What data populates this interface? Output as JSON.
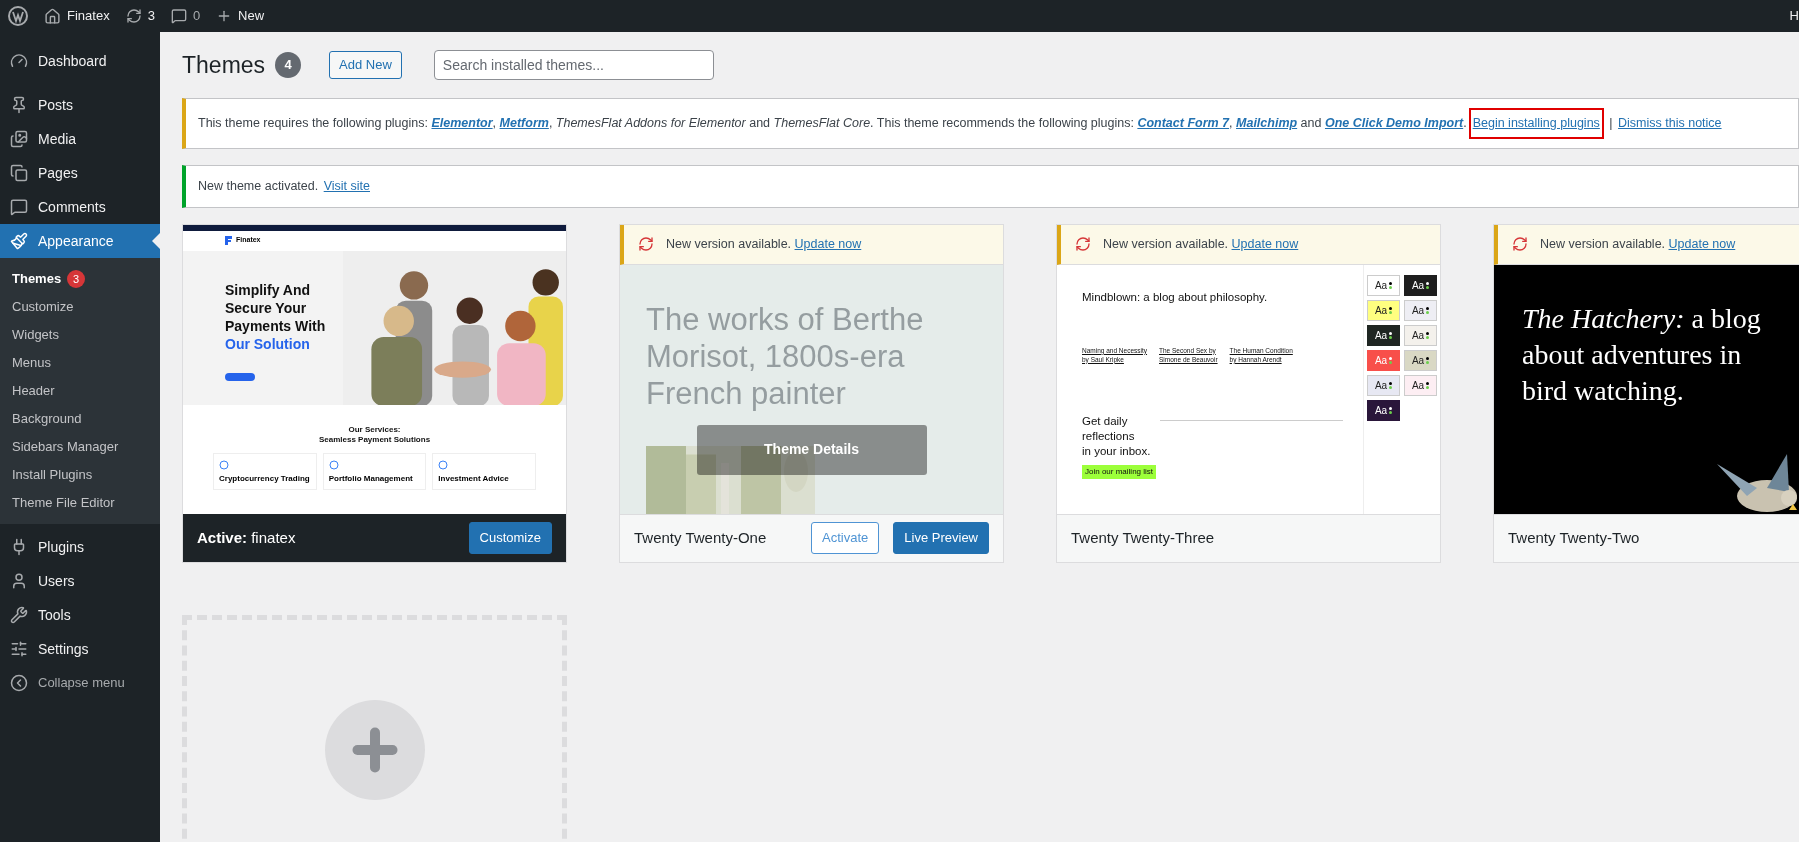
{
  "admin_bar": {
    "site": "Finatex",
    "updates": "3",
    "comments": "0",
    "new": "New",
    "account": "H"
  },
  "sidebar": {
    "items": [
      {
        "label": "Dashboard",
        "selected": false
      },
      {
        "label": "Posts",
        "selected": false
      },
      {
        "label": "Media",
        "selected": false
      },
      {
        "label": "Pages",
        "selected": false
      },
      {
        "label": "Comments",
        "selected": false
      },
      {
        "label": "Appearance",
        "selected": true,
        "children": [
          {
            "label": "Themes",
            "selected": true,
            "badge": "3"
          },
          {
            "label": "Customize",
            "selected": false
          },
          {
            "label": "Widgets",
            "selected": false
          },
          {
            "label": "Menus",
            "selected": false
          },
          {
            "label": "Header",
            "selected": false
          },
          {
            "label": "Background",
            "selected": false
          },
          {
            "label": "Sidebars Manager",
            "selected": false
          },
          {
            "label": "Install Plugins",
            "selected": false
          },
          {
            "label": "Theme File Editor",
            "selected": false
          }
        ]
      },
      {
        "label": "Plugins",
        "selected": false
      },
      {
        "label": "Users",
        "selected": false
      },
      {
        "label": "Tools",
        "selected": false
      },
      {
        "label": "Settings",
        "selected": false
      }
    ],
    "collapse": "Collapse menu"
  },
  "page": {
    "title": "Themes",
    "count": "4",
    "add_new": "Add New",
    "search": {
      "placeholder": "Search installed themes..."
    }
  },
  "notices": [
    {
      "kind": "warning",
      "parts": [
        {
          "kind": "text",
          "text": "This theme requires the following plugins: "
        },
        {
          "kind": "link",
          "text": "Elementor"
        },
        {
          "kind": "text",
          "text": ", "
        },
        {
          "kind": "link",
          "text": "Metform"
        },
        {
          "kind": "text",
          "text": ", "
        },
        {
          "kind": "italic",
          "text": "ThemesFlat Addons for Elementor"
        },
        {
          "kind": "text",
          "text": " and "
        },
        {
          "kind": "italic",
          "text": "ThemesFlat Core"
        },
        {
          "kind": "text",
          "text": ". This theme recommends the following plugins: "
        },
        {
          "kind": "link",
          "text": "Contact Form 7"
        },
        {
          "kind": "text",
          "text": ", "
        },
        {
          "kind": "link",
          "text": "Mailchimp"
        },
        {
          "kind": "text",
          "text": " and "
        },
        {
          "kind": "link",
          "text": "One Click Demo Import"
        },
        {
          "kind": "text",
          "text": "."
        },
        {
          "kind": "action",
          "text": "Begin installing plugins",
          "highlighted": true
        },
        {
          "kind": "text",
          "text": " | "
        },
        {
          "kind": "action",
          "text": "Dismiss this notice",
          "highlighted": false
        }
      ]
    },
    {
      "kind": "success",
      "parts": [
        {
          "kind": "text",
          "text": "New theme activated. "
        },
        {
          "kind": "action",
          "text": "Visit site",
          "highlighted": false
        }
      ]
    }
  ],
  "themes": [
    {
      "kind": "finatex",
      "active": true,
      "hovered": false,
      "active_label": "Active:",
      "name": "finatex",
      "actions": [
        "Customize"
      ],
      "preview": {
        "logo": "Finatex",
        "headline": [
          "Simplify And",
          "Secure Your",
          "Payments With"
        ],
        "accent": "Our Solution",
        "section_title": [
          "Our Services:",
          "Seamless Payment Solutions"
        ],
        "services": [
          "Cryptocurrency Trading",
          "Portfolio Management",
          "Investment Advice"
        ]
      }
    },
    {
      "kind": "twentyone",
      "active": false,
      "hovered": true,
      "name": "Twenty Twenty-One",
      "update": {
        "text": "New version available.",
        "link": "Update now"
      },
      "details": "Theme Details",
      "actions": [
        "Activate",
        "Live Preview"
      ],
      "preview": {
        "headline": [
          "The works of Berthe",
          "Morisot, 1800s-era",
          "French painter"
        ]
      }
    },
    {
      "kind": "twentythree",
      "active": false,
      "hovered": false,
      "name": "Twenty Twenty-Three",
      "update": {
        "text": "New version available.",
        "link": "Update now"
      },
      "preview": {
        "headline": "Mindblown: a blog about philosophy.",
        "posts": [
          [
            "Naming and Necessity",
            "by Saul Kripke"
          ],
          [
            "The Second Sex by",
            "Simone de Beauvoir"
          ],
          [
            "The Human Condition",
            "by Hannah Arendt"
          ]
        ],
        "cta": [
          "Get daily",
          "reflections",
          "in your inbox."
        ],
        "button": "Join our mailing list",
        "styles": [
          {
            "label": "Aa",
            "color": "#ffffff"
          },
          {
            "label": "Aa",
            "color": "#1e1e1e"
          },
          {
            "label": "Aa",
            "color": "#ffff80"
          },
          {
            "label": "Aa",
            "color": "#eeeef4"
          },
          {
            "label": "Aa",
            "color": "#1f2622"
          },
          {
            "label": "Aa",
            "color": "#f4f1ec"
          },
          {
            "label": "Aa",
            "color": "#f84f4a"
          },
          {
            "label": "Aa",
            "color": "#d9d8c4"
          },
          {
            "label": "Aa",
            "color": "#e7e8f3"
          },
          {
            "label": "Aa",
            "color": "#fdeef3"
          },
          {
            "label": "Aa",
            "color": "#2a163a"
          }
        ]
      }
    },
    {
      "kind": "twentytwo",
      "active": false,
      "hovered": false,
      "name": "Twenty Twenty-Two",
      "update": {
        "text": "New version available.",
        "link": "Update now"
      },
      "preview": {
        "headline": [
          "*The Hatchery:* a blog",
          "about adventures in",
          "bird watching."
        ]
      }
    }
  ]
}
